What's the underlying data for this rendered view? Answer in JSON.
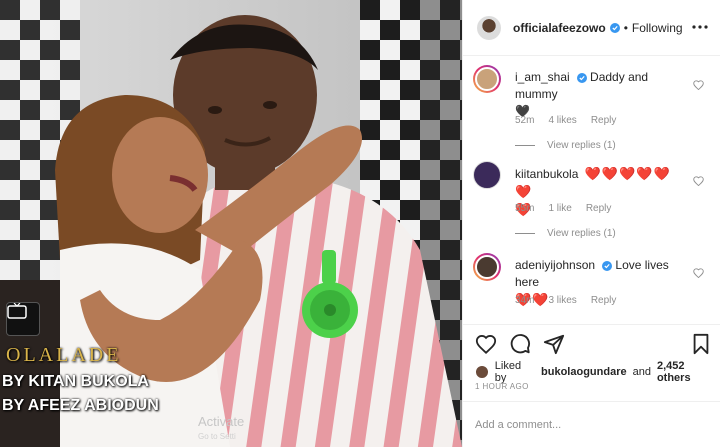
{
  "post": {
    "username": "officialafeezowo",
    "separator": "•",
    "follow_status": "Following",
    "photo_text": {
      "title": "OLALADE",
      "line1": "BY KITAN BUKOLA",
      "line2": "BY AFEEZ ABIODUN"
    }
  },
  "comments": [
    {
      "username": "i_am_shai",
      "verified": true,
      "text": "Daddy and mummy",
      "emoji": "🖤",
      "time": "52m",
      "likes": "4 likes",
      "reply": "Reply",
      "view_replies": "View replies (1)"
    },
    {
      "username": "kiitanbukola",
      "verified": false,
      "text": "",
      "emoji": "❤️❤️❤️❤️❤️❤️",
      "emoji2": "❤️",
      "time": "55m",
      "likes": "1 like",
      "reply": "Reply",
      "view_replies": "View replies (1)"
    },
    {
      "username": "adeniyijohnson",
      "verified": true,
      "text": "Love lives here",
      "emoji": "❤️❤️",
      "time": "34m",
      "likes": "3 likes",
      "reply": "Reply"
    }
  ],
  "actions": {
    "icons": [
      "heart-icon",
      "comment-icon",
      "share-icon",
      "bookmark-icon"
    ]
  },
  "likes_line": {
    "prefix": "Liked by",
    "user": "bukolaogundare",
    "and": "and",
    "count": "2,452 others"
  },
  "timestamp": "1 HOUR AGO",
  "add_comment": {
    "placeholder": "Add a comment..."
  },
  "watermark": {
    "main": "Activate",
    "sub": "Go to Setti"
  },
  "colors": {
    "verified": "#3897f0",
    "like_red": "#ed4956",
    "muted": "#8e8e8e",
    "border": "#efefef"
  }
}
